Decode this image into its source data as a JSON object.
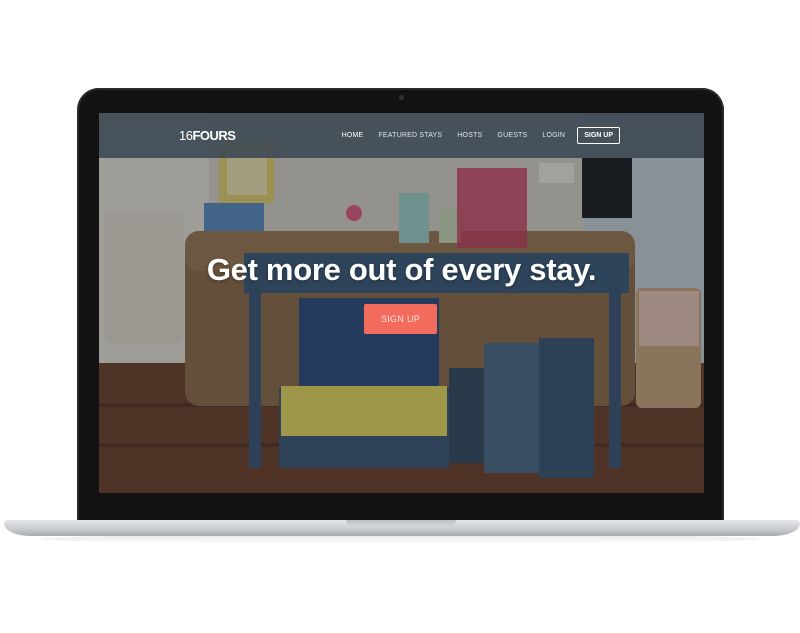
{
  "site": {
    "logo_number": "16",
    "logo_word": "FOURS"
  },
  "nav": {
    "items": [
      {
        "label": "HOME",
        "active": true
      },
      {
        "label": "FEATURED STAYS",
        "active": false
      },
      {
        "label": "HOSTS",
        "active": false
      },
      {
        "label": "GUESTS",
        "active": false
      },
      {
        "label": "LOGIN",
        "active": false
      }
    ],
    "signup_label": "SIGN UP"
  },
  "hero": {
    "headline": "Get more out of every stay.",
    "cta_label": "SIGN UP",
    "background": "living room with blue console table and vintage suitcases"
  },
  "colors": {
    "accent": "#f26b5c",
    "navbar": "#3a4652",
    "laptop_bezel": "#121213",
    "laptop_base": "#c8c9cc"
  }
}
